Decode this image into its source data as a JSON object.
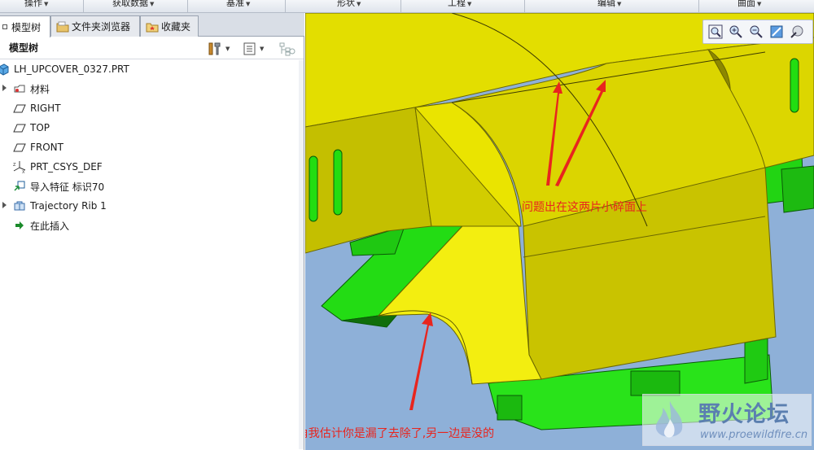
{
  "ribbon": {
    "groups": [
      "操作",
      "获取数据",
      "基准",
      "形状",
      "工程",
      "编辑",
      "曲面"
    ]
  },
  "left_panel": {
    "tabs": [
      {
        "label": "模型树",
        "icon": "model-tree-icon",
        "active": true
      },
      {
        "label": "文件夹浏览器",
        "icon": "folder-icon",
        "active": false
      },
      {
        "label": "收藏夹",
        "icon": "favorites-icon",
        "active": false
      }
    ],
    "tree_header": "模型树",
    "tree": [
      {
        "label": "LH_UPCOVER_0327.PRT",
        "icon": "part-icon",
        "expandable": false
      },
      {
        "label": "材料",
        "icon": "material-icon",
        "expandable": true
      },
      {
        "label": "RIGHT",
        "icon": "datum-plane-icon",
        "expandable": false
      },
      {
        "label": "TOP",
        "icon": "datum-plane-icon",
        "expandable": false
      },
      {
        "label": "FRONT",
        "icon": "datum-plane-icon",
        "expandable": false
      },
      {
        "label": "PRT_CSYS_DEF",
        "icon": "coordinate-system-icon",
        "expandable": false
      },
      {
        "label": "导入特征 标识70",
        "icon": "import-feature-icon",
        "expandable": false
      },
      {
        "label": "Trajectory Rib 1",
        "icon": "rib-feature-icon",
        "expandable": true
      },
      {
        "label": "在此插入",
        "icon": "insert-here-arrow-icon",
        "expandable": false
      }
    ]
  },
  "annotations": {
    "note_top": "问题出在这两片小碎面上",
    "note_bottom": "这里R角我估计你是漏了去除了,另一边是没的"
  },
  "watermark": {
    "title": "野火论坛",
    "url": "www.proewildfire.cn"
  },
  "colors": {
    "background": "#8eb0d8",
    "part_yellow": "#e6e000",
    "part_green": "#22dd11",
    "annotation_red": "#e8251e"
  }
}
